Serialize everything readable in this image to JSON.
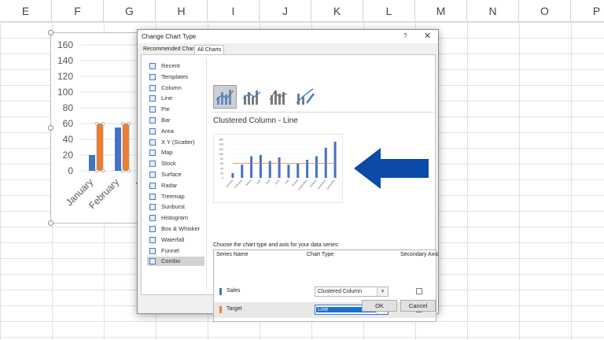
{
  "sheet": {
    "columns": [
      "E",
      "F",
      "G",
      "H",
      "I",
      "J",
      "K",
      "L",
      "M",
      "N",
      "O",
      "P"
    ],
    "chart": {
      "y_ticks": [
        "160",
        "140",
        "120",
        "100",
        "80",
        "60",
        "40",
        "20",
        "0"
      ],
      "categories": [
        "January",
        "February",
        "M"
      ],
      "sales": [
        20,
        55,
        0
      ],
      "target": [
        60,
        60,
        0
      ],
      "colors": {
        "sales": "#4472c4",
        "target": "#ed7d31"
      }
    }
  },
  "dialog": {
    "title": "Change Chart Type",
    "help": "?",
    "close": "✕",
    "tabs": [
      "Recommended Charts",
      "All Charts"
    ],
    "chart_types": [
      {
        "label": "Recent",
        "icon": "recent-icon"
      },
      {
        "label": "Templates",
        "icon": "templates-icon"
      },
      {
        "label": "Column",
        "icon": "column-chart-icon"
      },
      {
        "label": "Line",
        "icon": "line-chart-icon"
      },
      {
        "label": "Pie",
        "icon": "pie-chart-icon"
      },
      {
        "label": "Bar",
        "icon": "bar-chart-icon"
      },
      {
        "label": "Area",
        "icon": "area-chart-icon"
      },
      {
        "label": "X Y (Scatter)",
        "icon": "scatter-chart-icon"
      },
      {
        "label": "Map",
        "icon": "map-chart-icon"
      },
      {
        "label": "Stock",
        "icon": "stock-chart-icon"
      },
      {
        "label": "Surface",
        "icon": "surface-chart-icon"
      },
      {
        "label": "Radar",
        "icon": "radar-chart-icon"
      },
      {
        "label": "Treemap",
        "icon": "treemap-chart-icon"
      },
      {
        "label": "Sunburst",
        "icon": "sunburst-chart-icon"
      },
      {
        "label": "Histogram",
        "icon": "histogram-chart-icon"
      },
      {
        "label": "Box & Whisker",
        "icon": "box-whisker-chart-icon"
      },
      {
        "label": "Waterfall",
        "icon": "waterfall-chart-icon"
      },
      {
        "label": "Funnel",
        "icon": "funnel-chart-icon"
      },
      {
        "label": "Combo",
        "icon": "combo-chart-icon"
      }
    ],
    "selected_type": "Combo",
    "subtype_title": "Clustered Column - Line",
    "preview": {
      "y_ticks": [
        "160",
        "140",
        "120",
        "100",
        "80",
        "60",
        "40",
        "20",
        "0"
      ],
      "months": [
        "January",
        "February",
        "March",
        "April",
        "May",
        "June",
        "July",
        "August",
        "September",
        "October",
        "November",
        "December"
      ],
      "sales": [
        20,
        55,
        90,
        95,
        70,
        85,
        55,
        60,
        75,
        90,
        125,
        150
      ],
      "target": 60
    },
    "series_caption": "Choose the chart type and axis for your data series:",
    "table_headers": {
      "name": "Series Name",
      "type": "Chart Type",
      "axis": "Secondary Axis"
    },
    "series": [
      {
        "name": "Sales",
        "type": "Clustered Column",
        "color": "#4472c4",
        "secondary": false
      },
      {
        "name": "Target",
        "type": "Line",
        "color": "#ed7d31",
        "secondary": false
      }
    ],
    "ok": "OK",
    "cancel": "Cancel",
    "arrow_color": "#0b4aa8"
  }
}
